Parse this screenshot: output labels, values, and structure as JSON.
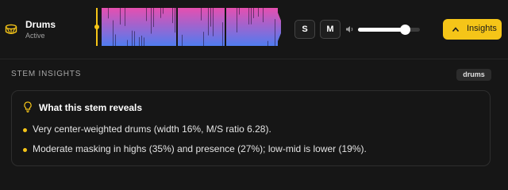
{
  "track": {
    "name": "Drums",
    "status": "Active",
    "icon": "drum-icon",
    "solo_label": "S",
    "mute_label": "M",
    "volume": 0.76,
    "insights_label": "Insights",
    "insights_icon": "chevron-up-icon"
  },
  "waveform": {
    "gradient_top": "#e64fb0",
    "gradient_bottom": "#4f7cf0",
    "cursor_color": "#f5c518"
  },
  "panel": {
    "title": "STEM INSIGHTS",
    "stem_badge": "drums",
    "card": {
      "icon": "lightbulb-icon",
      "title": "What this stem reveals",
      "insights": [
        "Very center-weighted drums (width 16%, M/S ratio 6.28).",
        "Moderate masking in highs (35%) and presence (27%); low-mid is lower (19%)."
      ]
    }
  },
  "colors": {
    "accent": "#f5c518",
    "background": "#161616"
  }
}
